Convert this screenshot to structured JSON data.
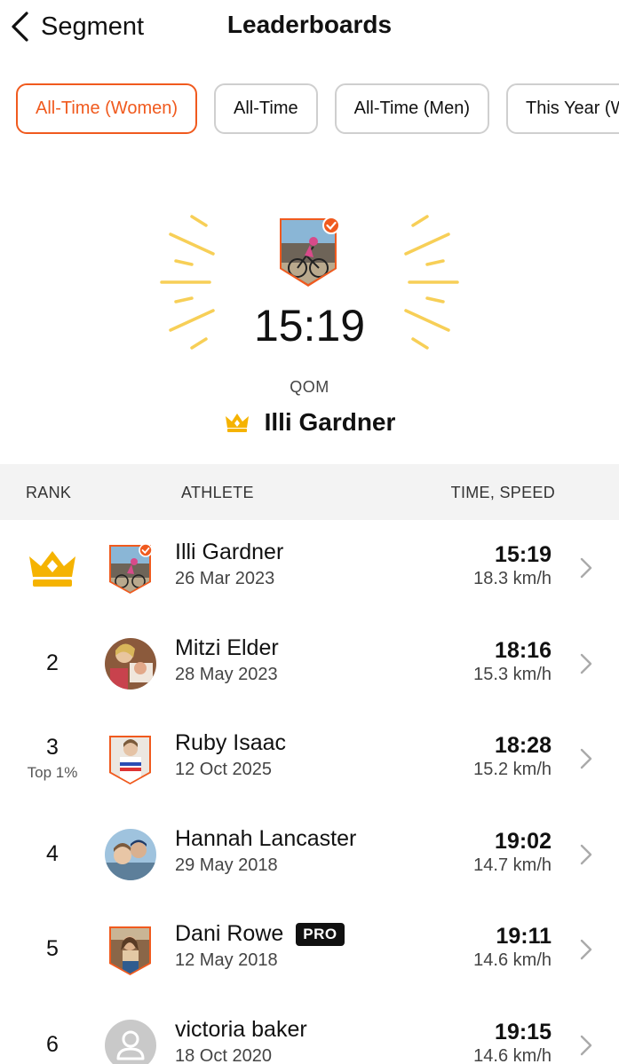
{
  "header": {
    "back_label": "Segment",
    "title": "Leaderboards"
  },
  "filters": [
    {
      "label": "All-Time (Women)",
      "active": true
    },
    {
      "label": "All-Time",
      "active": false
    },
    {
      "label": "All-Time (Men)",
      "active": false
    },
    {
      "label": "This Year (W",
      "active": false
    }
  ],
  "hero": {
    "time": "15:19",
    "label": "QOM",
    "name": "Illi Gardner"
  },
  "table": {
    "col_rank": "RANK",
    "col_athlete": "ATHLETE",
    "col_time": "TIME, SPEED"
  },
  "entries": [
    {
      "rank": "",
      "rank_note": "",
      "name": "Illi Gardner",
      "date": "26 Mar 2023",
      "time": "15:19",
      "speed": "18.3 km/h",
      "pro": "",
      "avatar": "badge-photo-icon"
    },
    {
      "rank": "2",
      "rank_note": "",
      "name": "Mitzi Elder",
      "date": "28 May 2023",
      "time": "18:16",
      "speed": "15.3 km/h",
      "pro": "",
      "avatar": "circle-photo"
    },
    {
      "rank": "3",
      "rank_note": "Top 1%",
      "name": "Ruby Isaac",
      "date": "12 Oct 2025",
      "time": "18:28",
      "speed": "15.2 km/h",
      "pro": "",
      "avatar": "badge-photo-icon"
    },
    {
      "rank": "4",
      "rank_note": "",
      "name": "Hannah Lancaster",
      "date": "29 May 2018",
      "time": "19:02",
      "speed": "14.7 km/h",
      "pro": "",
      "avatar": "circle-photo"
    },
    {
      "rank": "5",
      "rank_note": "",
      "name": "Dani Rowe",
      "date": "12 May 2018",
      "time": "19:11",
      "speed": "14.6 km/h",
      "pro": "PRO",
      "avatar": "badge-photo-icon"
    },
    {
      "rank": "6",
      "rank_note": "",
      "name": "victoria baker",
      "date": "18 Oct 2020",
      "time": "19:15",
      "speed": "14.6 km/h",
      "pro": "",
      "avatar": "default-person-icon"
    }
  ],
  "colors": {
    "accent": "#f05a1e",
    "crown": "#f5b301",
    "rays": "#f7cf57"
  }
}
